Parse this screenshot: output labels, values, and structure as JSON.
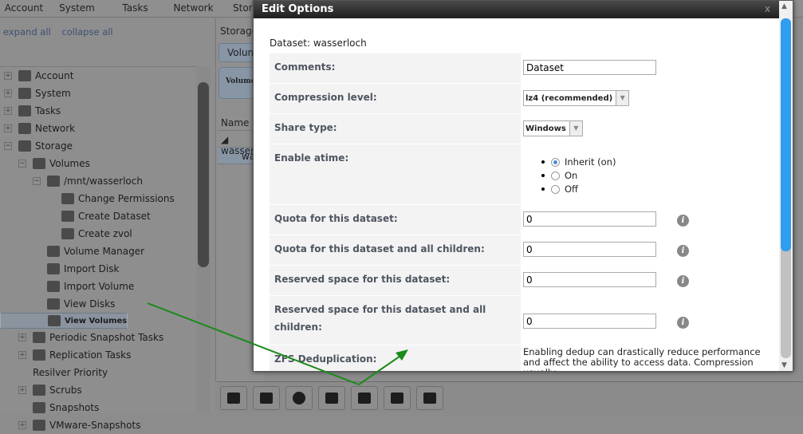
{
  "menu": [
    "Account",
    "System",
    "Tasks",
    "Network",
    "Storage"
  ],
  "links": {
    "expand": "expand all",
    "collapse": "collapse all"
  },
  "tree": [
    {
      "label": "Account",
      "level": 0,
      "pm": "+"
    },
    {
      "label": "System",
      "level": 0,
      "pm": "+"
    },
    {
      "label": "Tasks",
      "level": 0,
      "pm": "+"
    },
    {
      "label": "Network",
      "level": 0,
      "pm": "+"
    },
    {
      "label": "Storage",
      "level": 0,
      "pm": "−"
    },
    {
      "label": "Volumes",
      "level": 1,
      "pm": "−"
    },
    {
      "label": "/mnt/wasserloch",
      "level": 2,
      "pm": "−"
    },
    {
      "label": "Change Permissions",
      "level": 3,
      "pm": ""
    },
    {
      "label": "Create Dataset",
      "level": 3,
      "pm": ""
    },
    {
      "label": "Create zvol",
      "level": 3,
      "pm": ""
    },
    {
      "label": "Volume Manager",
      "level": 2,
      "pm": ""
    },
    {
      "label": "Import Disk",
      "level": 2,
      "pm": ""
    },
    {
      "label": "Import Volume",
      "level": 2,
      "pm": ""
    },
    {
      "label": "View Disks",
      "level": 2,
      "pm": ""
    },
    {
      "label": "View Volumes",
      "level": 2,
      "pm": "",
      "selected": true
    },
    {
      "label": "Periodic Snapshot Tasks",
      "level": 1,
      "pm": "+"
    },
    {
      "label": "Replication Tasks",
      "level": 1,
      "pm": "+"
    },
    {
      "label": "Resilver Priority",
      "level": 1,
      "pm": "",
      "noicon": true
    },
    {
      "label": "Scrubs",
      "level": 1,
      "pm": "+"
    },
    {
      "label": "Snapshots",
      "level": 1,
      "pm": ""
    },
    {
      "label": "VMware-Snapshots",
      "level": 1,
      "pm": "+"
    }
  ],
  "mid": {
    "tab": "Storage",
    "volumes_btn": "Volumes",
    "volume_btn2": "Volume",
    "col_name": "Name",
    "row1": "◢ wasserloch",
    "row2": "wasserloch"
  },
  "modal": {
    "title": "Edit Options",
    "close": "x",
    "dataset": "Dataset: wasserloch",
    "comments_label": "Comments:",
    "comments_value": "Dataset",
    "compression_label": "Compression level:",
    "compression_value": "lz4 (recommended)",
    "share_label": "Share type:",
    "share_value": "Windows",
    "atime_label": "Enable atime:",
    "atime_options": [
      "Inherit (on)",
      "On",
      "Off"
    ],
    "atime_selected": "Inherit (on)",
    "quota_label": "Quota for this dataset:",
    "quota_value": "0",
    "quota_children_label": "Quota for this dataset and all children:",
    "quota_children_value": "0",
    "reserved_label": "Reserved space for this dataset:",
    "reserved_value": "0",
    "reserved_all_label": "Reserved space for this dataset and all children:",
    "reserved_all_value": "0",
    "dedup_label": "ZFS Deduplication:",
    "dedup_text": "Enabling dedup can drastically reduce performance and affect the ability to access data. Compression usually"
  },
  "toolbar_icons": [
    "change-permissions-icon",
    "create-dataset-icon",
    "upgrade-icon",
    "destroy-icon",
    "edit-options-icon",
    "create-zvol-icon",
    "snapshot-icon"
  ],
  "colors": {
    "annotation_arrow": "#1a8a1a",
    "scroll_thumb": "#2f9df0"
  }
}
